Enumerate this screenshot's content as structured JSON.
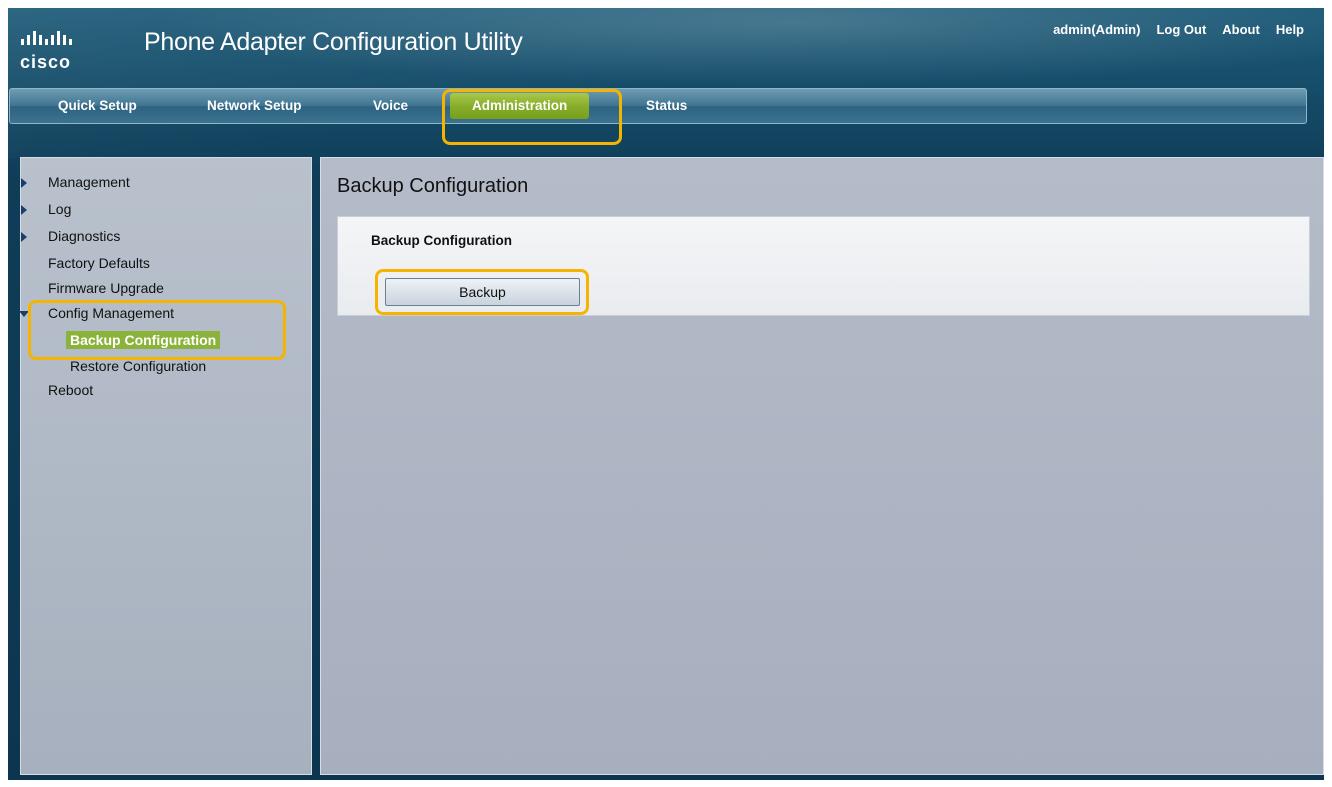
{
  "header": {
    "logo_text": "cisco",
    "title": "Phone Adapter Configuration Utility",
    "user": "admin(Admin)",
    "logout": "Log Out",
    "about": "About",
    "help": "Help"
  },
  "tabs": [
    {
      "label": "Quick Setup"
    },
    {
      "label": "Network Setup"
    },
    {
      "label": "Voice"
    },
    {
      "label": "Administration",
      "active": true
    },
    {
      "label": "Status"
    }
  ],
  "sidebar": {
    "items": [
      {
        "label": "Management",
        "expander": "collapsed"
      },
      {
        "label": "Log",
        "expander": "collapsed"
      },
      {
        "label": "Diagnostics",
        "expander": "collapsed"
      },
      {
        "label": "Factory Defaults"
      },
      {
        "label": "Firmware Upgrade"
      },
      {
        "label": "Config Management",
        "expander": "expanded"
      },
      {
        "label": "Backup Configuration",
        "selected": true
      },
      {
        "label": "Restore Configuration"
      },
      {
        "label": "Reboot"
      }
    ]
  },
  "main": {
    "page_title": "Backup Configuration",
    "section_heading": "Backup Configuration",
    "backup_button": "Backup"
  },
  "colors": {
    "highlight": "#f5b400",
    "active_green": "#8bb33a",
    "header_blue": "#144a66"
  }
}
